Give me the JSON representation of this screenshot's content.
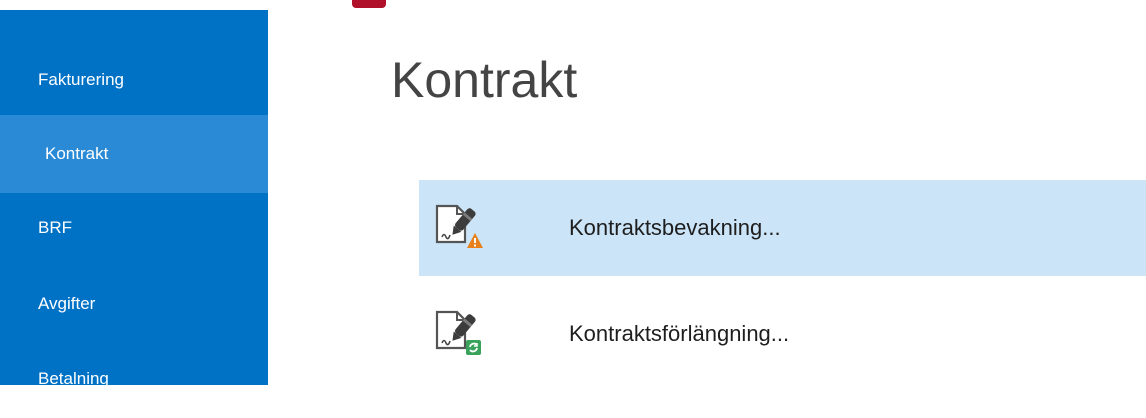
{
  "sidebar": {
    "items": [
      {
        "label": "Fakturering",
        "active": false
      },
      {
        "label": "Kontrakt",
        "active": true
      },
      {
        "label": "BRF",
        "active": false
      },
      {
        "label": "Avgifter",
        "active": false
      },
      {
        "label": "Betalning",
        "active": false
      }
    ]
  },
  "main": {
    "title": "Kontrakt",
    "commands": [
      {
        "label": "Kontraktsbevakning...",
        "icon": "contract-warning-icon",
        "selected": true
      },
      {
        "label": "Kontraktsförlängning...",
        "icon": "contract-renew-icon",
        "selected": false
      }
    ]
  },
  "colors": {
    "sidebar_bg": "#0072c6",
    "sidebar_active": "#2a8ad6",
    "selection_bg": "#cce4f7",
    "accent": "#b0102a",
    "warning": "#e8811c",
    "renew": "#3aa35b"
  }
}
